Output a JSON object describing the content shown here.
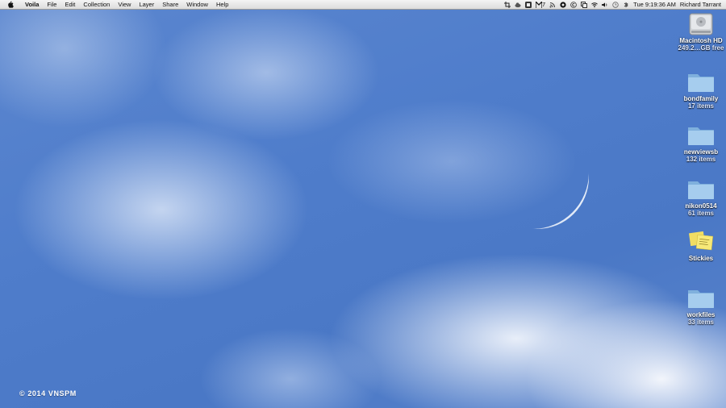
{
  "menubar": {
    "app_name": "Voila",
    "menus": [
      "File",
      "Edit",
      "Collection",
      "View",
      "Layer",
      "Share",
      "Window",
      "Help"
    ],
    "status_text_m7": "7",
    "clock": "Tue 9:19:36 AM",
    "user": "Richard Tarrant",
    "status_icons": [
      "crop-icon",
      "cloud-icon",
      "app-icon",
      "mail-icon",
      "rss-icon",
      "circle-icon",
      "copyright-icon",
      "copy-icon",
      "wifi-icon",
      "volume-icon",
      "time-machine-icon",
      "bluetooth-icon"
    ]
  },
  "desktop": {
    "icons": [
      {
        "label": "Macintosh HD",
        "sub": "249.2…GB free",
        "icon": "hard-drive-icon"
      },
      {
        "label": "bondfamily",
        "sub": "17 items",
        "icon": "folder-icon"
      },
      {
        "label": "newviewsb",
        "sub": "132 items",
        "icon": "folder-icon"
      },
      {
        "label": "nikon0514",
        "sub": "61 items",
        "icon": "folder-icon"
      },
      {
        "label": "Stickies",
        "sub": "",
        "icon": "stickies-icon"
      },
      {
        "label": "workfiles",
        "sub": "33 items",
        "icon": "folder-icon"
      }
    ],
    "watermark": "© 2014 VNSPM"
  },
  "colors": {
    "sky": "#4f7dcb",
    "menubar": "#e8e8e8",
    "folder": "#9cc3e6"
  }
}
